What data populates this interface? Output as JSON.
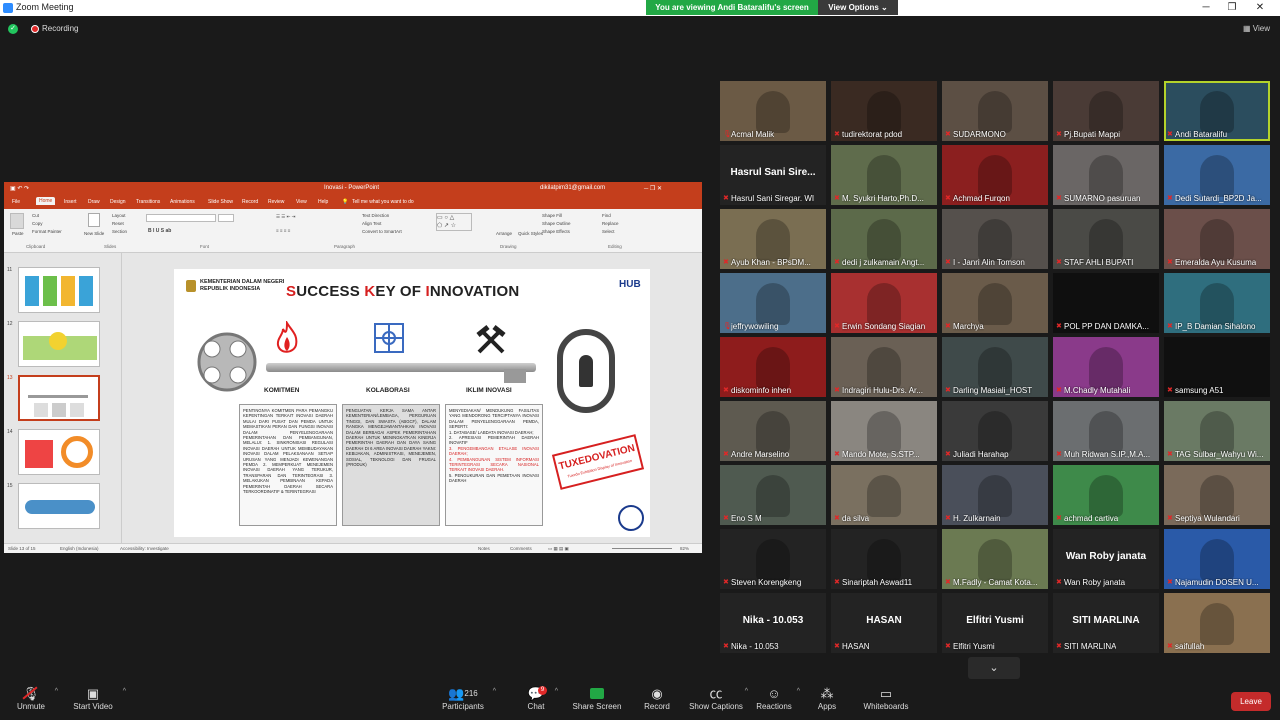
{
  "window": {
    "title": "Zoom Meeting"
  },
  "banner": {
    "viewing": "You are viewing Andi Bataralifu's screen",
    "view_options": "View Options"
  },
  "topbar": {
    "recording": "Recording",
    "view": "View"
  },
  "powerpoint": {
    "doc_title": "Inovasi - PowerPoint",
    "account": "dikilatpim31@gmail.com",
    "tabs": [
      "File",
      "Home",
      "Insert",
      "Draw",
      "Design",
      "Transitions",
      "Animations",
      "Slide Show",
      "Record",
      "Review",
      "View",
      "Help"
    ],
    "tell_me": "Tell me what you want to do",
    "ribbon": {
      "paste": "Paste",
      "cut": "Cut",
      "copy": "Copy",
      "format_painter": "Format Painter",
      "new_slide": "New Slide",
      "layout": "Layout",
      "reset": "Reset",
      "section": "Section",
      "text_direction": "Text Direction",
      "align_text": "Align Text",
      "convert_smartart": "Convert to SmartArt",
      "arrange": "Arrange",
      "quick_styles": "Quick Styles",
      "shape_fill": "Shape Fill",
      "shape_outline": "Shape Outline",
      "shape_effects": "Shape Effects",
      "find": "Find",
      "replace": "Replace",
      "select": "Select",
      "groups": {
        "clipboard": "Clipboard",
        "slides": "Slides",
        "font": "Font",
        "paragraph": "Paragraph",
        "drawing": "Drawing",
        "editing": "Editing"
      }
    },
    "thumbnails": [
      "11",
      "12",
      "13",
      "14",
      "15"
    ],
    "status": {
      "slide": "Slide 13 of 15",
      "language": "English (Indonesia)",
      "accessibility": "Accessibility: Investigate",
      "notes": "Notes",
      "comments": "Comments",
      "zoom": "82%"
    },
    "slide": {
      "org_line1": "KEMENTERIAN DALAM NEGERI",
      "org_line2": "REPUBLIK INDONESIA",
      "title_parts": [
        {
          "t": "S",
          "red": true
        },
        {
          "t": "UCCESS ",
          "red": false
        },
        {
          "t": "K",
          "red": true
        },
        {
          "t": "EY OF ",
          "red": false
        },
        {
          "t": "I",
          "red": true
        },
        {
          "t": "NNOVATION",
          "red": false
        }
      ],
      "hub": "HUB",
      "pillars": [
        "KOMITMEN",
        "KOLABORASI",
        "IKLIM INOVASI"
      ],
      "box1": "PENTINGNYA KOMITMEN PARA PEMANGKU KEPENTINGAN TERKAIT INOVASI DAERAH MULAI DARI PUSAT DAN PEMDA UNTUK MEMASTIKAN PERAN DAN FUNGSI INOVASI DALAM PENYELENGGARAAN PEMERINTAHAN DAN PEMBANGUNAN, MELALUI: 1. SINKRONISASI REGULASI INOVASI DAERAH UNTUK MEMBUDAYAKAN INOVASI DALAM PELAKSANAAN SETIAP URUSAN YANG MENJADI KEWENANGAN PEMDA 2. MEMPERKUAT MENEJEMEN INOVASI DAERAH YANG TERUKUR, TRANSPARAN DAN TERINTEGRASI 3. MELAKUKAN PEMBINAAN KEPADA PEMERINTAH DAERAH SECARA TERKOORDINATIF & TERINTEGRASI",
      "box2": "PENGUATAN KERJA SAMA ANTAR KEMENTERIAN/LEMBAGA, PERGURUAN TINGGI, DAN SWASTA (ABGCF), DALAM RANGKA MENGEJAWANTAHKAN INOVASI DALAM BERBAGAI ASPEK PEMERINTAHAN DAERAH UNTUK MENINGKATKAN KINERJA PEMERINTAH DAERAH DAN DAYA SAING DAERAH DI 6 AREA INOVASI DAERAH YAKNI: KEBIJAKAN, ADMINISTRASI, MENEJEMEN, SOSIAL, TEKNOLOGI DAN FRUGAL (PRODUK)",
      "box3_intro": "MENYEDIAKAN/ MENDUKUNG FASILITAS YANG MENDORONG TERCIPTANYA INOVASI DALAM PENYELENGGARAAN PEMDA, SEPERTI:",
      "box3_items": [
        {
          "t": "1. DATABASE/ LABDATA INOVASI DAERAH;",
          "red": false
        },
        {
          "t": "2. APRESIASI PEMERINTAH DAERAH INOVATIF",
          "red": false
        },
        {
          "t": "3. PENGEMBANGAN ETALASE INOVASI DAERAH;",
          "red": true
        },
        {
          "t": "4. PEMBANGUNAN SISTEM INFORMASI TERINTEGRASI SECARA NASIONAL TERKAIT INOVASI DAERAH.",
          "red": true
        },
        {
          "t": "5. PENGUKURAN DAN PEMETAAN INOVASI DAERAH",
          "red": false
        }
      ],
      "stamp": "TUXEDOVATION",
      "stamp_sub": "Tuxedo Exhibition Display of Innovation"
    }
  },
  "gallery": [
    {
      "name": "Acmal Malik",
      "color": "#6b5a45",
      "muted": false
    },
    {
      "name": "tudirektorat pdod",
      "color": "#3a2a22",
      "muted": true
    },
    {
      "name": "SUDARMONO",
      "color": "#5c4f44",
      "muted": true
    },
    {
      "name": "Pj.Bupati Mappi",
      "color": "#4a3b36",
      "muted": true
    },
    {
      "name": "Andi Bataralifu",
      "color": "#2b4d5e",
      "muted": true,
      "active": true
    },
    {
      "name": "Hasrul Sani Siregar. WI",
      "color": "#232323",
      "muted": true,
      "big": "Hasrul  Sani  Sire..."
    },
    {
      "name": "M. Syukri Harto,Ph.D...",
      "color": "#5f6c4c",
      "muted": true
    },
    {
      "name": "Achmad Furqon",
      "color": "#8b1f1f",
      "muted": true
    },
    {
      "name": "SUMARNO pasuruan",
      "color": "#6a6665",
      "muted": true
    },
    {
      "name": "Dedi Sutardi_BP2D Ja...",
      "color": "#3b6aa4",
      "muted": true
    },
    {
      "name": "Ayub Khan - BPsDM...",
      "color": "#7a6e52",
      "muted": true
    },
    {
      "name": "dedi j zulkamain Angt...",
      "color": "#5c6a4a",
      "muted": true
    },
    {
      "name": "I - Janri Alin Tomson",
      "color": "#55504c",
      "muted": true
    },
    {
      "name": "STAF AHLI BUPATI",
      "color": "#4a4a46",
      "muted": true
    },
    {
      "name": "Emeralda Ayu Kusuma",
      "color": "#6b4f4a",
      "muted": true
    },
    {
      "name": "jeffrywowiling",
      "color": "#4c6e8a",
      "muted": false
    },
    {
      "name": "Erwin Sondang Siagian",
      "color": "#a83030",
      "muted": true
    },
    {
      "name": "Marchya",
      "color": "#6a5b4a",
      "muted": true
    },
    {
      "name": "POL PP DAN DAMKA...",
      "color": "#0f0f0f",
      "muted": true
    },
    {
      "name": "IP_B Damian Sihalono",
      "color": "#2f6e7e",
      "muted": true
    },
    {
      "name": "diskominfo inhen",
      "color": "#8e1c1c",
      "muted": true
    },
    {
      "name": "Indragiri Hulu-Drs. Ar...",
      "color": "#6a6055",
      "muted": true
    },
    {
      "name": "Darling Masiali_HOST",
      "color": "#3f4a4a",
      "muted": true
    },
    {
      "name": "M.Chadly Mutahali",
      "color": "#8a3a8a",
      "muted": true
    },
    {
      "name": "samsung A51",
      "color": "#101010",
      "muted": true
    },
    {
      "name": "Andre Marselino",
      "color": "#5e5a50",
      "muted": true
    },
    {
      "name": "Mando Mote, S.STP...",
      "color": "#8a8680",
      "muted": true
    },
    {
      "name": "Juliadi Harahap",
      "color": "#3a3a3a",
      "muted": true
    },
    {
      "name": "Muh Ridwan S.IP.,M.A...",
      "color": "#6b6e70",
      "muted": true
    },
    {
      "name": "TAG Sulbar_Wahyu Wi...",
      "color": "#6a7a64",
      "muted": true
    },
    {
      "name": "Eno S M",
      "color": "#4f5a50",
      "muted": true
    },
    {
      "name": "da silva",
      "color": "#7a7060",
      "muted": true
    },
    {
      "name": "H. Zulkarnain",
      "color": "#4a4f5a",
      "muted": true
    },
    {
      "name": "achmad cartiva",
      "color": "#3e8a4a",
      "muted": true
    },
    {
      "name": "Septiya Wulandari",
      "color": "#7a6a5a",
      "muted": true
    },
    {
      "name": "Steven Korengkeng",
      "color": "#232323",
      "muted": true
    },
    {
      "name": "Sinariptah Aswad11",
      "color": "#232323",
      "muted": true
    },
    {
      "name": "M.Fadly - Camat Kota...",
      "color": "#6b7a52",
      "muted": true
    },
    {
      "name": "Wan Roby janata",
      "color": "#232323",
      "muted": true,
      "big": "Wan Roby janata"
    },
    {
      "name": "Najamudin DOSEN U...",
      "color": "#2a5aa8",
      "muted": true
    },
    {
      "name": "Nika - 10.053",
      "color": "#232323",
      "muted": true,
      "big": "Nika - 10.053"
    },
    {
      "name": "HASAN",
      "color": "#232323",
      "muted": true,
      "big": "HASAN"
    },
    {
      "name": "Elfitri Yusmi",
      "color": "#232323",
      "muted": true,
      "big": "Elfitri Yusmi"
    },
    {
      "name": "SITI MARLINA",
      "color": "#232323",
      "muted": true,
      "big": "SITI MARLINA"
    },
    {
      "name": "saifullah",
      "color": "#8a7050",
      "muted": true
    }
  ],
  "toolbar": {
    "unmute": "Unmute",
    "start_video": "Start Video",
    "participants": "Participants",
    "participants_count": "216",
    "chat": "Chat",
    "chat_badge": "9",
    "share_screen": "Share Screen",
    "record": "Record",
    "show_captions": "Show Captions",
    "reactions": "Reactions",
    "apps": "Apps",
    "whiteboards": "Whiteboards",
    "leave": "Leave"
  }
}
